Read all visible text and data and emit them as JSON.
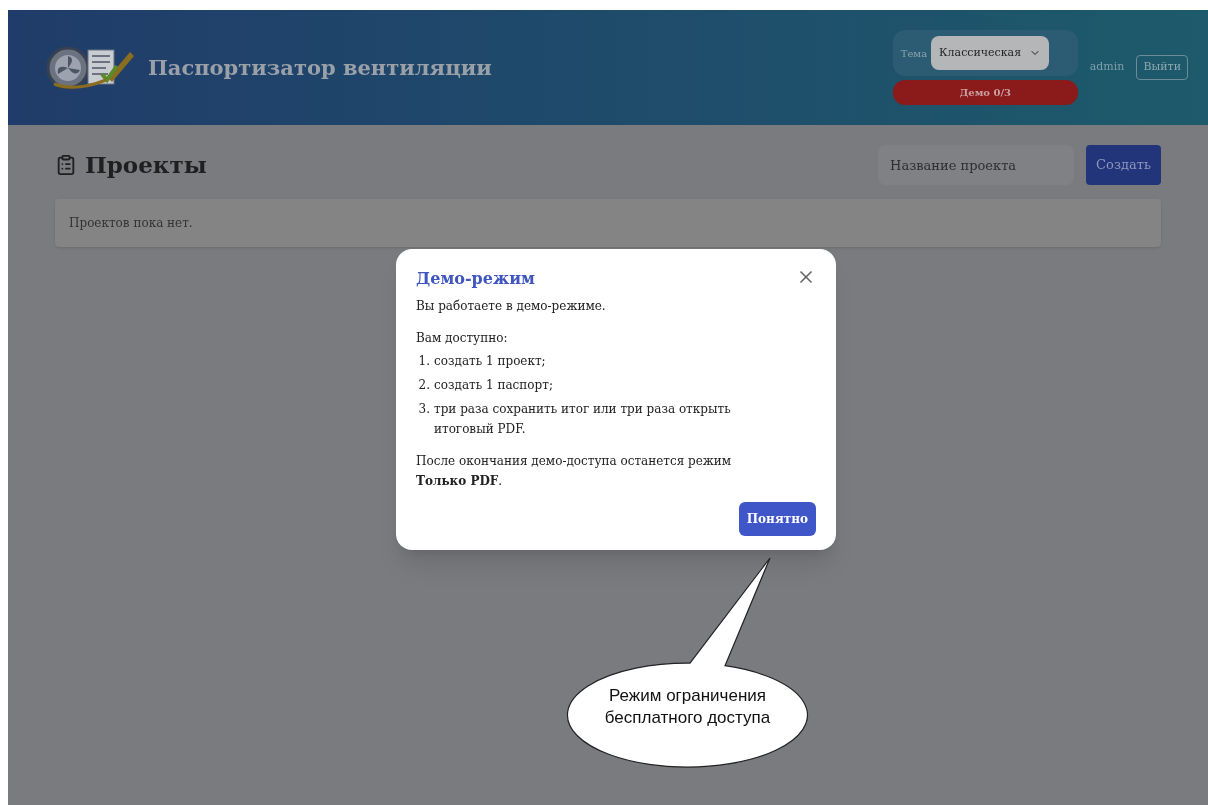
{
  "header": {
    "app_title": "Паспортизатор вентиляции",
    "theme": {
      "label": "Тема",
      "value": "Классическая"
    },
    "demo_badge": "Демо 0/3",
    "user": "admin",
    "logout": "Выйти"
  },
  "page": {
    "title": "Проекты",
    "new_project": {
      "placeholder": "Название проекта"
    },
    "create_button": "Создать",
    "empty_message": "Проектов пока нет."
  },
  "dialog": {
    "title": "Демо-режим",
    "intro": "Вы работаете в демо-режиме.",
    "list_heading": "Вам доступно:",
    "items": [
      {
        "number": "1.",
        "text": "создать 1 проект;"
      },
      {
        "number": "2.",
        "text": "создать 1 паспорт;"
      },
      {
        "number": "3.",
        "text": "три раза сохранить итог или три раза открыть итоговый PDF."
      }
    ],
    "closing": "После окончания демо-доступа останется режим **Только PDF**.",
    "ok_button": "Понятно"
  },
  "callout": {
    "text": "Режим ограничения бесплатного доступа"
  }
}
